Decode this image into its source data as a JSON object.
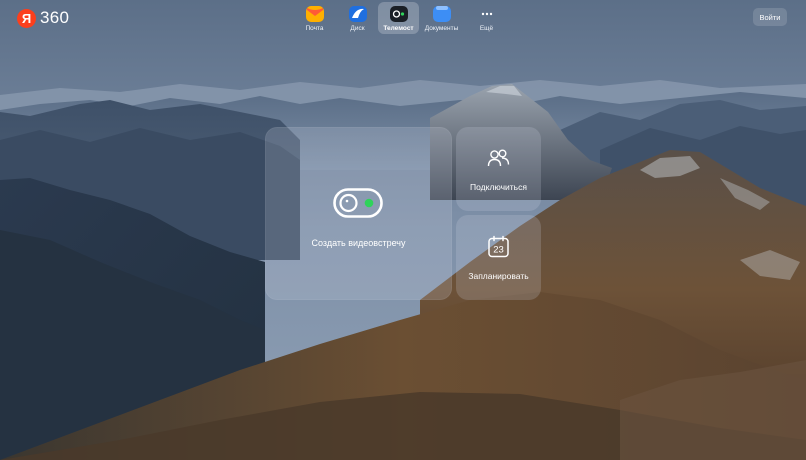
{
  "brand": {
    "logo_letter": "Я",
    "logo_text": "360"
  },
  "services": [
    {
      "label": "Почта",
      "icon": "mail-icon",
      "active": false
    },
    {
      "label": "Диск",
      "icon": "disk-icon",
      "active": false
    },
    {
      "label": "Телемост",
      "icon": "telemost-icon",
      "active": true
    },
    {
      "label": "Документы",
      "icon": "documents-icon",
      "active": false
    },
    {
      "label": "Ещё",
      "icon": "more-icon",
      "active": false
    }
  ],
  "header": {
    "login_label": "Войти"
  },
  "actions": {
    "create_meeting_label": "Создать видеовстречу",
    "join_label": "Подключиться",
    "schedule_label": "Запланировать",
    "calendar_day": "23"
  },
  "colors": {
    "accent_green": "#2fd35a",
    "logo_red": "#fc3f1d"
  }
}
